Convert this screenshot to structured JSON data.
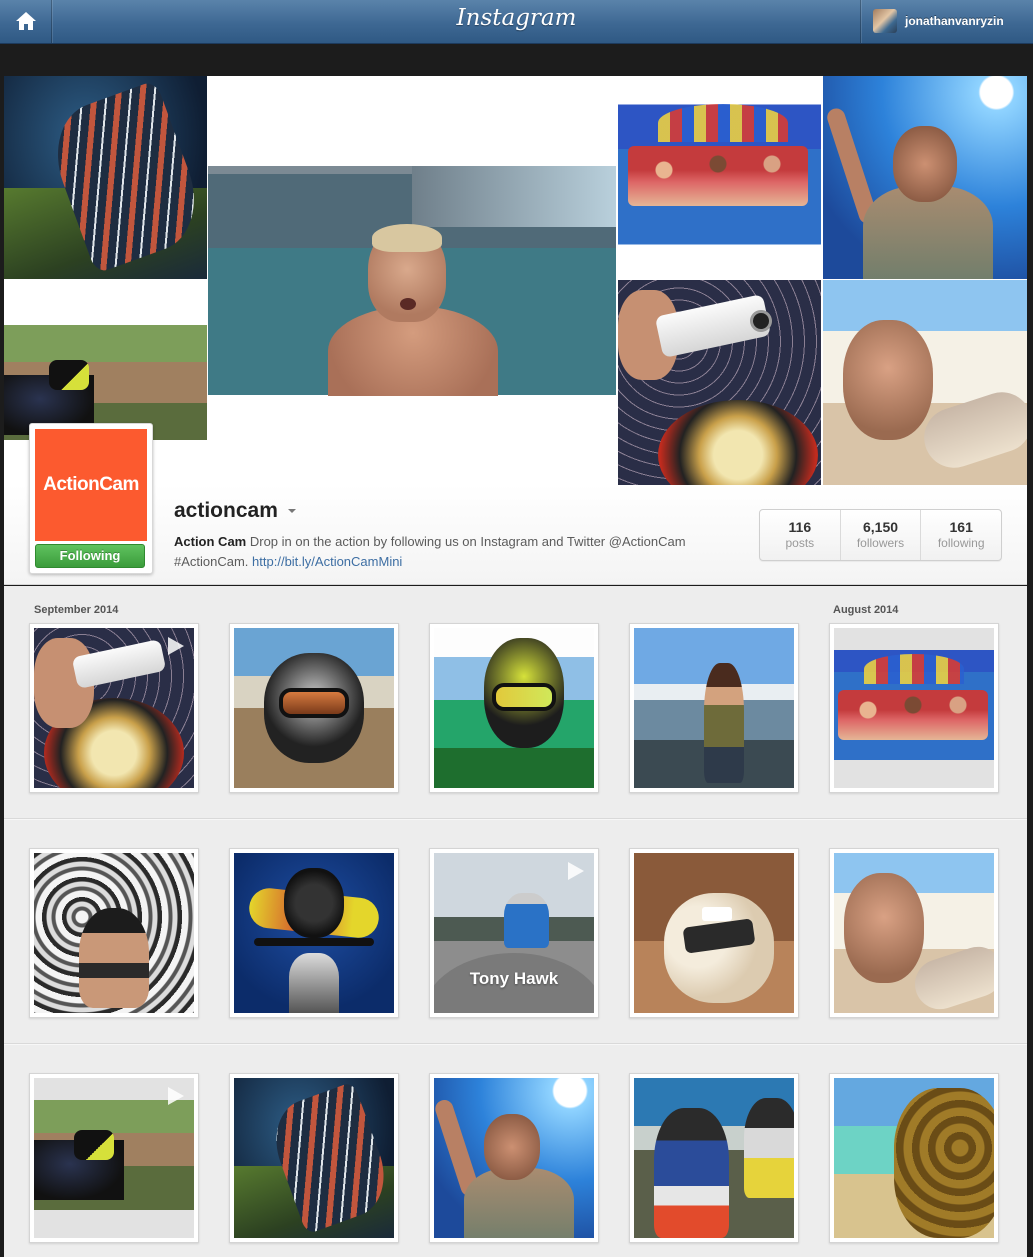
{
  "topbar": {
    "brand": "Instagram",
    "username": "jonathanvanryzin",
    "icons": [
      "home-icon"
    ]
  },
  "profile": {
    "logo_text": "ActionCam",
    "follow_label": "Following",
    "username": "actioncam",
    "bio_name": "Action Cam",
    "bio_text": " Drop in on the action by following us on Instagram and Twitter @ActionCam #ActionCam. ",
    "bio_link": "http://bit.ly/ActionCamMini",
    "stats": [
      {
        "value": "116",
        "label": "posts"
      },
      {
        "value": "6,150",
        "label": "followers"
      },
      {
        "value": "161",
        "label": "following"
      }
    ]
  },
  "feed": {
    "month_1": "September 2014",
    "month_2": "August 2014",
    "overlay_text": "Tony Hawk"
  },
  "colors": {
    "topbar": "#3e6893",
    "logo": "#fc5a2f",
    "follow_button": "#47a847",
    "link": "#3d6ea3"
  }
}
